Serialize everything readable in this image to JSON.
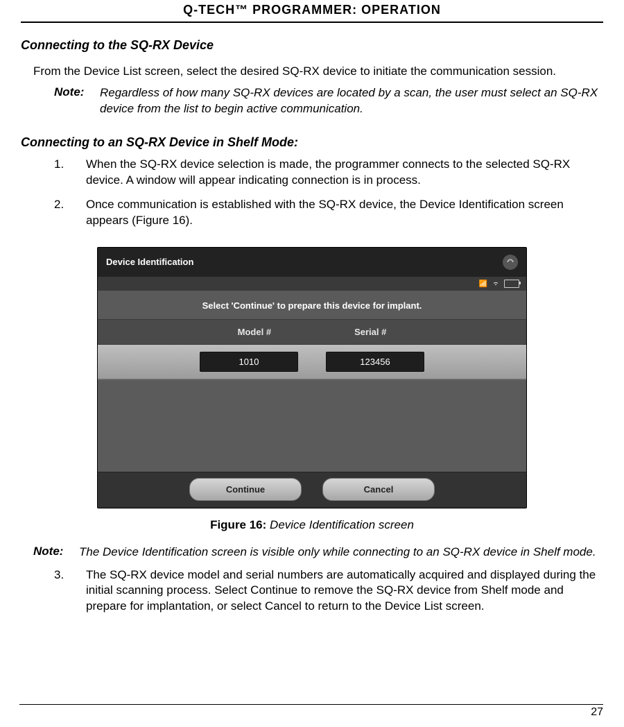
{
  "header": "Q-TECH™ PROGRAMMER:  OPERATION",
  "section_title": "Connecting to the SQ-RX Device",
  "intro": "From the Device List screen, select the desired SQ-RX device to initiate the communication session.",
  "note1": {
    "label": "Note:",
    "text": "Regardless of how many SQ-RX devices are located by a scan, the user must select an SQ-RX device from the list to begin active communication."
  },
  "subheading": "Connecting to an SQ-RX Device in Shelf Mode:",
  "steps": [
    {
      "num": "1.",
      "text": "When the SQ-RX device selection is made, the programmer connects to the selected SQ-RX device. A window will appear indicating connection is in process."
    },
    {
      "num": "2.",
      "text": "Once communication is established with the SQ-RX device, the Device Identification screen appears (Figure 16)."
    }
  ],
  "device": {
    "title": "Device Identification",
    "instruction": "Select 'Continue' to prepare this device for implant.",
    "col_model": "Model #",
    "col_serial": "Serial #",
    "val_model": "1010",
    "val_serial": "123456",
    "btn_continue": "Continue",
    "btn_cancel": "Cancel"
  },
  "figure": {
    "label": "Figure 16:",
    "text": " Device Identification screen"
  },
  "note2": {
    "label": "Note:",
    "text": "The Device Identification screen is visible only while connecting to an SQ-RX device in Shelf mode."
  },
  "step3": {
    "num": "3.",
    "text": "The SQ-RX device model and serial numbers are automatically acquired and displayed during the initial scanning process. Select Continue to remove the SQ-RX device from Shelf mode and prepare for implantation, or select Cancel to return to the Device List screen."
  },
  "page_number": "27"
}
